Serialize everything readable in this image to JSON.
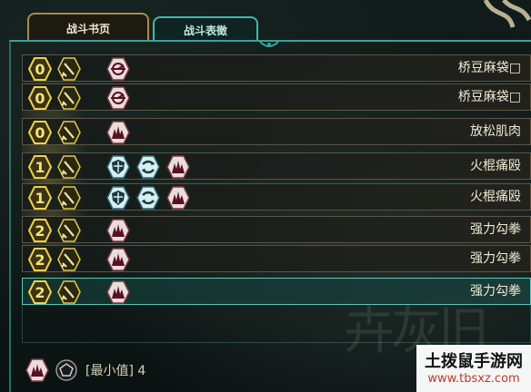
{
  "tabs": [
    {
      "label": "战斗书页",
      "active": true
    },
    {
      "label": "战斗表徵",
      "active": false
    }
  ],
  "cards": [
    {
      "cost": "0",
      "effects": [
        "pierce-icon"
      ],
      "name": "桥豆麻袋□"
    },
    {
      "cost": "0",
      "effects": [
        "pierce-icon"
      ],
      "name": "桥豆麻袋□"
    },
    {
      "cost": "0",
      "effects": [
        "damage-icon"
      ],
      "name": "放松肌肉"
    },
    {
      "cost": "1",
      "effects": [
        "shield-icon",
        "evade-icon",
        "damage-icon"
      ],
      "name": "火棍痛殴"
    },
    {
      "cost": "1",
      "effects": [
        "shield-icon",
        "evade-icon",
        "damage-icon"
      ],
      "name": "火棍痛殴"
    },
    {
      "cost": "2",
      "effects": [
        "damage-icon"
      ],
      "name": "强力勾拳"
    },
    {
      "cost": "2",
      "effects": [
        "damage-icon"
      ],
      "name": "强力勾拳"
    },
    {
      "cost": "2",
      "effects": [
        "damage-icon"
      ],
      "name": "强力勾拳",
      "selected": true
    }
  ],
  "footer": {
    "label": "[最小值] 4"
  },
  "watermark": {
    "title": "土拨鼠手游网",
    "url": "www.tbsxz.com"
  },
  "colors": {
    "gold": "#e2c24e",
    "teal": "#43b7a9",
    "cardText": "#f1e9d6"
  }
}
